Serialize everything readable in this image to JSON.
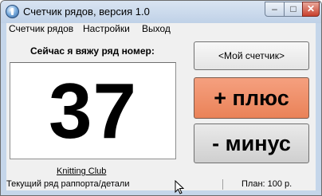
{
  "window": {
    "title": "Счетчик рядов, версия 1.0"
  },
  "menu": {
    "items": [
      "Счетчик рядов",
      "Настройки",
      "Выход"
    ]
  },
  "main": {
    "heading": "Сейчас я вяжу ряд номер:",
    "counter_value": "37",
    "link_text": "Knitting Club"
  },
  "buttons": {
    "my_counter": "<Мой счетчик>",
    "plus": "+ плюс",
    "minus": "- минус"
  },
  "status": {
    "left": "Текущий ряд раппорта/детали",
    "right": "План: 100 р."
  },
  "colors": {
    "plus_button": "#ea8258",
    "minus_button": "#cfcfcf",
    "window_frame": "#c5d6ea",
    "close_button": "#c8402c"
  },
  "icons": [
    "app-icon",
    "minimize-icon",
    "maximize-icon",
    "close-icon",
    "mouse-cursor-icon"
  ]
}
